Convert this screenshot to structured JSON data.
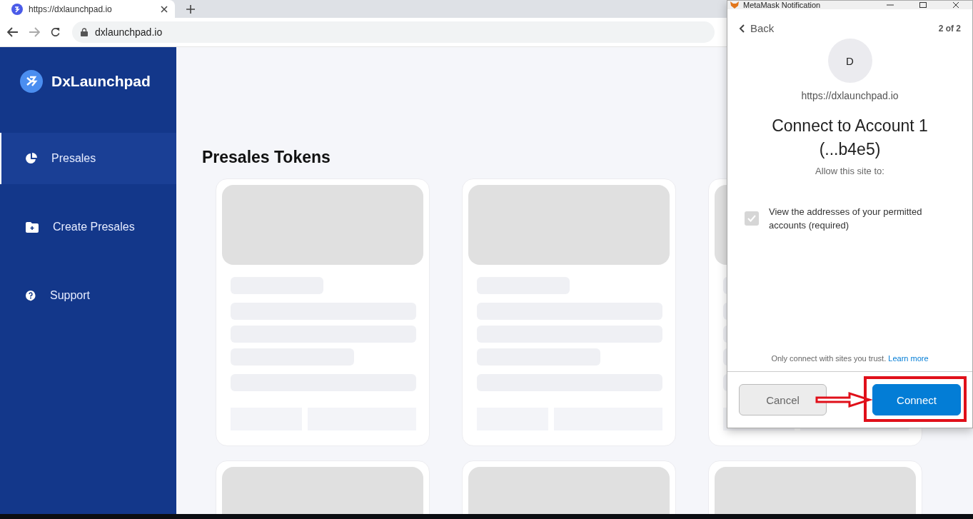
{
  "browser": {
    "tab": {
      "title": "https://dxlaunchpad.io"
    },
    "address": "dxlaunchpad.io"
  },
  "sidebar": {
    "brand": "DxLaunchpad",
    "items": [
      {
        "label": "Presales",
        "kind": "chart",
        "selected": true
      },
      {
        "label": "Create Presales",
        "kind": "folder",
        "selected": false
      },
      {
        "label": "Support",
        "kind": "help",
        "selected": false
      }
    ]
  },
  "page": {
    "title": "Presales Tokens",
    "cards": [
      {
        "loading": true
      },
      {
        "loading": true
      },
      {
        "loading": true
      },
      {
        "loading": true
      },
      {
        "loading": true
      },
      {
        "loading": true
      }
    ]
  },
  "popup": {
    "title": "MetaMask Notification",
    "back": "Back",
    "step": "2 of 2",
    "avatar": "D",
    "origin": "https://dxlaunchpad.io",
    "heading": "Connect to Account 1 (...b4e5)",
    "subheading": "Allow this site to:",
    "permissions": [
      {
        "label": "View the addresses of your permitted accounts (required)",
        "checked": true,
        "disabled": true
      }
    ],
    "note": "Only connect with sites you trust.",
    "link": "Learn more",
    "buttons": [
      {
        "label": "Cancel",
        "kind": "secondary"
      },
      {
        "label": "Connect",
        "kind": "primary"
      }
    ]
  }
}
